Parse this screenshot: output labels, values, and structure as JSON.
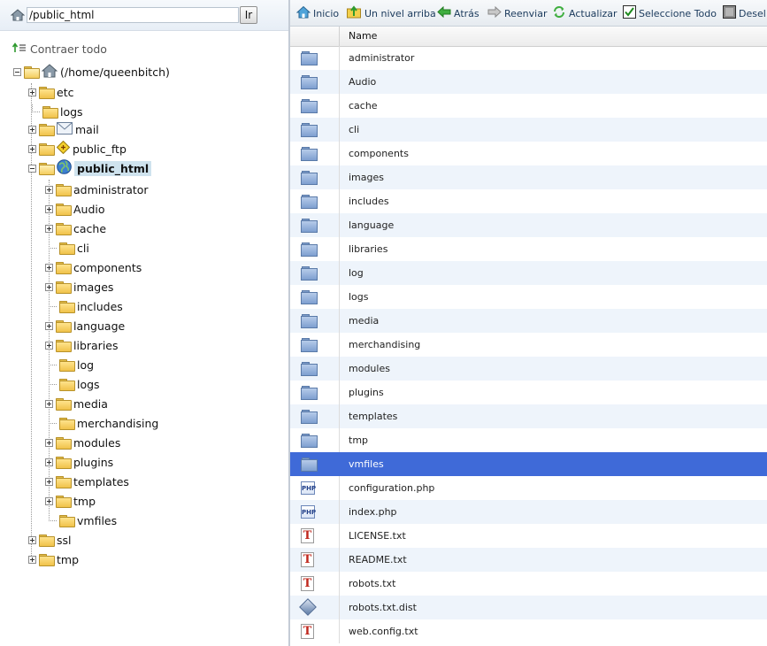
{
  "pathbar": {
    "path_value": "/public_html",
    "go_label": "Ir"
  },
  "tree": {
    "collapse_label": "Contraer todo",
    "root_label": "(/home/queenbitch)",
    "top_items": [
      {
        "label": "etc",
        "expander": "plus",
        "icon": "folder-icon"
      },
      {
        "label": "logs",
        "expander": "none",
        "icon": "folder-icon"
      },
      {
        "label": "mail",
        "expander": "plus",
        "icon": "mail-icon"
      },
      {
        "label": "public_ftp",
        "expander": "plus",
        "icon": "ftp-icon"
      },
      {
        "label": "public_html",
        "expander": "minus",
        "icon": "globe-icon",
        "selected": true
      }
    ],
    "public_html_children": [
      {
        "label": "administrator",
        "expander": "plus"
      },
      {
        "label": "Audio",
        "expander": "plus"
      },
      {
        "label": "cache",
        "expander": "plus"
      },
      {
        "label": "cli",
        "expander": "none"
      },
      {
        "label": "components",
        "expander": "plus"
      },
      {
        "label": "images",
        "expander": "plus"
      },
      {
        "label": "includes",
        "expander": "none"
      },
      {
        "label": "language",
        "expander": "plus"
      },
      {
        "label": "libraries",
        "expander": "plus"
      },
      {
        "label": "log",
        "expander": "none"
      },
      {
        "label": "logs",
        "expander": "none"
      },
      {
        "label": "media",
        "expander": "plus"
      },
      {
        "label": "merchandising",
        "expander": "none"
      },
      {
        "label": "modules",
        "expander": "plus"
      },
      {
        "label": "plugins",
        "expander": "plus"
      },
      {
        "label": "templates",
        "expander": "plus"
      },
      {
        "label": "tmp",
        "expander": "plus"
      },
      {
        "label": "vmfiles",
        "expander": "none"
      }
    ],
    "bottom_items": [
      {
        "label": "ssl",
        "expander": "plus"
      },
      {
        "label": "tmp",
        "expander": "plus"
      }
    ]
  },
  "toolbar": {
    "inicio": "Inicio",
    "nivel_arriba": "Un nivel arriba",
    "atras": "Atrás",
    "reenviar": "Reenviar",
    "actualizar": "Actualizar",
    "seleccione_todo": "Seleccione Todo",
    "deseleccionar": "Desel"
  },
  "file_list": {
    "column_name": "Name",
    "rows": [
      {
        "name": "administrator",
        "type": "folder"
      },
      {
        "name": "Audio",
        "type": "folder"
      },
      {
        "name": "cache",
        "type": "folder"
      },
      {
        "name": "cli",
        "type": "folder"
      },
      {
        "name": "components",
        "type": "folder"
      },
      {
        "name": "images",
        "type": "folder"
      },
      {
        "name": "includes",
        "type": "folder"
      },
      {
        "name": "language",
        "type": "folder"
      },
      {
        "name": "libraries",
        "type": "folder"
      },
      {
        "name": "log",
        "type": "folder"
      },
      {
        "name": "logs",
        "type": "folder"
      },
      {
        "name": "media",
        "type": "folder"
      },
      {
        "name": "merchandising",
        "type": "folder"
      },
      {
        "name": "modules",
        "type": "folder"
      },
      {
        "name": "plugins",
        "type": "folder"
      },
      {
        "name": "templates",
        "type": "folder"
      },
      {
        "name": "tmp",
        "type": "folder"
      },
      {
        "name": "vmfiles",
        "type": "folder",
        "selected": true
      },
      {
        "name": "configuration.php",
        "type": "php"
      },
      {
        "name": "index.php",
        "type": "php"
      },
      {
        "name": "LICENSE.txt",
        "type": "txt"
      },
      {
        "name": "README.txt",
        "type": "txt"
      },
      {
        "name": "robots.txt",
        "type": "txt"
      },
      {
        "name": "robots.txt.dist",
        "type": "dist"
      },
      {
        "name": "web.config.txt",
        "type": "txt"
      }
    ]
  },
  "icons": {
    "php_label": "PHP",
    "txt_label": "T"
  },
  "colors": {
    "selection": "#3f6ad8",
    "row_alt": "#eef4fb",
    "tree_selected": "#cfe3ee"
  }
}
